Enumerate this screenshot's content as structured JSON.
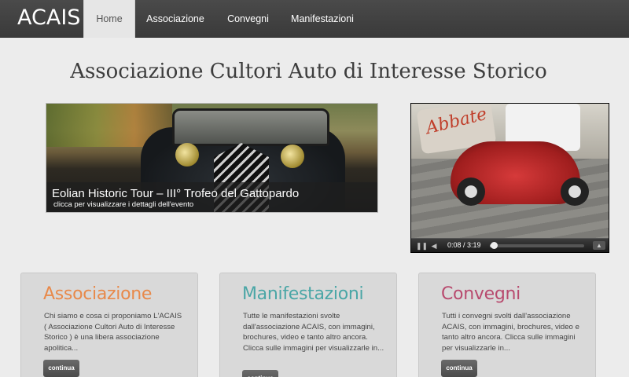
{
  "brand": "ACAIS",
  "nav": {
    "items": [
      {
        "label": "Home",
        "active": true
      },
      {
        "label": "Associazione",
        "active": false
      },
      {
        "label": "Convegni",
        "active": false
      },
      {
        "label": "Manifestazioni",
        "active": false
      }
    ]
  },
  "page_title": "Associazione Cultori Auto di Interesse Storico",
  "slider": {
    "title": "Eolian Historic Tour – III° Trofeo del Gattopardo",
    "subtitle": "clicca per visualizzare i dettagli dell'evento"
  },
  "video": {
    "time": "0:08 / 3:19",
    "progress": 0.04,
    "brand_text": "Abbate"
  },
  "cards": [
    {
      "title": "Associazione",
      "title_color": "#e8894a",
      "text": "Chi siamo e cosa ci proponiamo L'ACAIS ( Associazione Cultori Auto di Interesse Storico ) è una libera associazione apolitica...",
      "button": "continua"
    },
    {
      "title": "Manifestazioni",
      "title_color": "#4aa6a6",
      "text": "Tutte le manifestazioni svolte dall'associazione ACAIS, con immagini, brochures, video e tanto altro ancora. Clicca sulle immagini per visualizzarle in...",
      "button": "continua"
    },
    {
      "title": "Convegni",
      "title_color": "#b84a6e",
      "text": "Tutti i convegni svolti dall'associazione ACAIS, con immagini, brochures, video e tanto altro ancora. Clicca sulle immagini per visualizzarle in...",
      "button": "continua"
    }
  ]
}
